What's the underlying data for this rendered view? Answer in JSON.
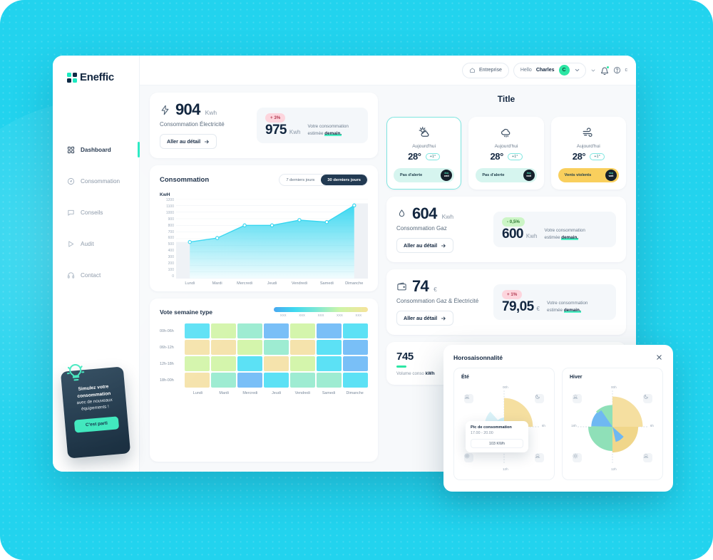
{
  "brand": {
    "name": "Eneffic"
  },
  "sidebar": {
    "items": [
      {
        "label": "Dashboard",
        "icon": "grid-icon",
        "active": true
      },
      {
        "label": "Consommation",
        "icon": "gauge-icon",
        "active": false
      },
      {
        "label": "Conseils",
        "icon": "chat-icon",
        "active": false
      },
      {
        "label": "Audit",
        "icon": "play-icon",
        "active": false
      },
      {
        "label": "Contact",
        "icon": "headphones-icon",
        "active": false
      }
    ],
    "promo": {
      "line1": "Simulez votre",
      "line2": "consommation",
      "line3": "avec de nouveaux",
      "line4": "équipements !",
      "button": "C'est parti"
    }
  },
  "topbar": {
    "entreprise": "Entreprise",
    "hello": "Hello",
    "username": "Charles",
    "avatar_initial": "C",
    "lang": "c"
  },
  "electricity": {
    "value": "904",
    "unit": "Kwh",
    "label": "Consommation Électricité",
    "button": "Aller au détail",
    "badge": "+ 3%",
    "badge_dir": "up",
    "estimate_value": "975",
    "estimate_unit": "Kwh",
    "estimate_text_1": "Votre consommation",
    "estimate_text_2": "estimée ",
    "estimate_text_3": "demain."
  },
  "gas": {
    "value": "604",
    "unit": "Kwh",
    "label": "Consommation Gaz",
    "button": "Aller au détail",
    "badge": "- 0,5%",
    "badge_dir": "down",
    "estimate_value": "600",
    "estimate_unit": "Kwh",
    "estimate_text_1": "Votre consommation",
    "estimate_text_2": "estimée ",
    "estimate_text_3": "demain."
  },
  "combined": {
    "value": "74",
    "unit": "€",
    "label": "Consommation Gaz & Électricité",
    "button": "Aller au détail",
    "badge": "+ 1%",
    "badge_dir": "up",
    "estimate_value": "79,05",
    "estimate_unit": "€",
    "estimate_text_1": "Votre consommation",
    "estimate_text_2": "estimée ",
    "estimate_text_3": "demain."
  },
  "weather": {
    "title": "Title",
    "cards": [
      {
        "icon": "sun-cloud-icon",
        "day": "Aujourd'hui",
        "temp": "28°",
        "delta": "+1°",
        "alert": "Pas d'alerte",
        "alert_type": "ok",
        "badge_top": "éco",
        "badge_bottom": "watt",
        "selected": true
      },
      {
        "icon": "cloud-rain-icon",
        "day": "Aujourd'hui",
        "temp": "28°",
        "delta": "+1°",
        "alert": "Pas d'alerte",
        "alert_type": "ok",
        "badge_top": "éco",
        "badge_bottom": "watt",
        "selected": false
      },
      {
        "icon": "wind-icon",
        "day": "Aujourd'hui",
        "temp": "28°",
        "delta": "+1°",
        "alert": "Vents violents",
        "alert_type": "warn",
        "badge_top": "éco",
        "badge_bottom": "watt",
        "selected": false
      }
    ]
  },
  "volume": {
    "value": "745",
    "label_1": "Volume conso ",
    "label_2": "kWh"
  },
  "modal": {
    "title": "Horosaisonnalité",
    "close_icon": "close-icon",
    "summer": {
      "title": "Été",
      "clock": {
        "top": "00h",
        "right": "6h",
        "bottom": "12h",
        "left": "18h"
      },
      "tooltip": {
        "title": "Pic de consommation",
        "range": "17.00 - 20.00",
        "value": "103 KWh"
      }
    },
    "winter": {
      "title": "Hiver",
      "clock": {
        "top": "00h",
        "right": "6h",
        "bottom": "12h",
        "left": "18h"
      }
    }
  },
  "chart_data": [
    {
      "type": "area",
      "title": "Consommation",
      "ylabel": "KwH",
      "xlabel": "",
      "categories": [
        "Lundi",
        "Mardi",
        "Mercredi",
        "Jeudi",
        "Vendredi",
        "Samedi",
        "Dimanche"
      ],
      "values": [
        550,
        610,
        800,
        800,
        880,
        850,
        1100
      ],
      "ylim": [
        0,
        1200
      ],
      "yticks": [
        1200,
        1100,
        1000,
        900,
        800,
        700,
        600,
        500,
        400,
        300,
        200,
        100,
        0
      ],
      "grid": true,
      "legend": "none",
      "series_color": "#35d6f0",
      "range_toggle": {
        "options": [
          "7 derniers jours",
          "30 derniers jours"
        ],
        "selected": "30 derniers jours"
      }
    },
    {
      "type": "heatmap",
      "title": "Vote semaine type",
      "xlabels": [
        "Lundi",
        "Mardi",
        "Mercredi",
        "Jeudi",
        "Vendredi",
        "Samedi",
        "Dimanche"
      ],
      "ylabels": [
        "00h-06h",
        "06h-12h",
        "12h-18h",
        "18h-00h"
      ],
      "legend_ticks": [
        "XXX",
        "XXX",
        "XXX",
        "XXX",
        "XXX"
      ],
      "legend_gradient": [
        "#4aa8f0",
        "#3fd9f0",
        "#7fe8d4",
        "#cdf5a8",
        "#f6e39a"
      ],
      "cells": [
        [
          "#5ce1f5",
          "#d4f5ac",
          "#9eecd2",
          "#79bff7",
          "#d4f5ac",
          "#79bff7",
          "#5ce1f5"
        ],
        [
          "#f5e3ac",
          "#f5e3ac",
          "#d4f5ac",
          "#9eecd2",
          "#f5e3ac",
          "#5ce1f5",
          "#79bff7"
        ],
        [
          "#d4f5ac",
          "#d4f5ac",
          "#5ce1f5",
          "#f5e3ac",
          "#d4f5ac",
          "#5ce1f5",
          "#79bff7"
        ],
        [
          "#f5e3ac",
          "#9eecd2",
          "#79bff7",
          "#5ce1f5",
          "#9eecd2",
          "#9eecd2",
          "#5ce1f5"
        ]
      ]
    },
    {
      "type": "pie",
      "title": "Été",
      "labels": [
        "00h-06h",
        "06h-12h",
        "12h-18h",
        "18h-00h"
      ],
      "values": [
        95,
        60,
        0,
        30
      ],
      "colors": [
        "#f5dfa0",
        "#f7ead0",
        "#b8ecd8",
        "#cdeef5"
      ]
    },
    {
      "type": "pie",
      "title": "Hiver",
      "labels": [
        "00h-06h",
        "06h-12h",
        "12h-18h",
        "18h-00h"
      ],
      "values": [
        100,
        85,
        80,
        70
      ],
      "colors": [
        "#f5dfa0",
        "#f0d68a",
        "#8fe0b8",
        "#6fb8f2"
      ]
    }
  ]
}
